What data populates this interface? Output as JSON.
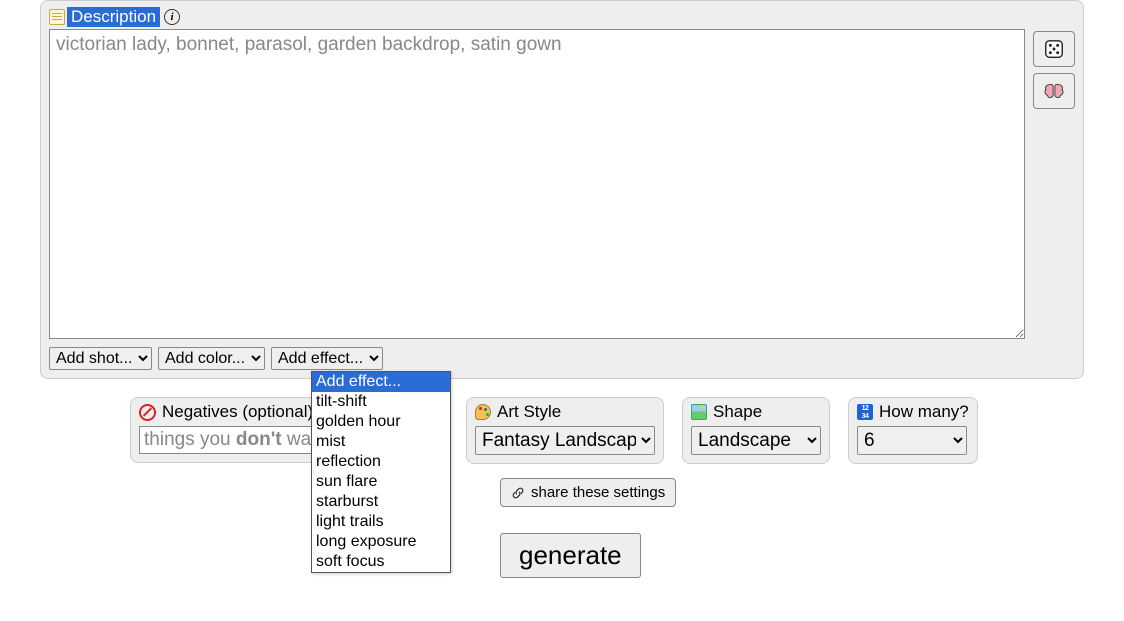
{
  "description": {
    "label": "Description",
    "placeholder": "victorian lady, bonnet, parasol, garden backdrop, satin gown",
    "value": ""
  },
  "add_selects": {
    "shot": "Add shot...",
    "color": "Add color...",
    "effect": "Add effect..."
  },
  "effect_options": [
    "Add effect...",
    "tilt-shift",
    "golden hour",
    "mist",
    "reflection",
    "sun flare",
    "starburst",
    "light trails",
    "long exposure",
    "soft focus"
  ],
  "negatives": {
    "label": "Negatives (optional)",
    "placeholder_prefix": "things you ",
    "placeholder_bold": "don't",
    "placeholder_suffix": " want"
  },
  "art_style": {
    "label": "Art Style",
    "value": "Fantasy Landscape"
  },
  "shape": {
    "label": "Shape",
    "value": "Landscape"
  },
  "how_many": {
    "label": "How many?",
    "value": "6"
  },
  "share_label": "share these settings",
  "generate_label": "generate",
  "num_icon_text": "12\n34"
}
